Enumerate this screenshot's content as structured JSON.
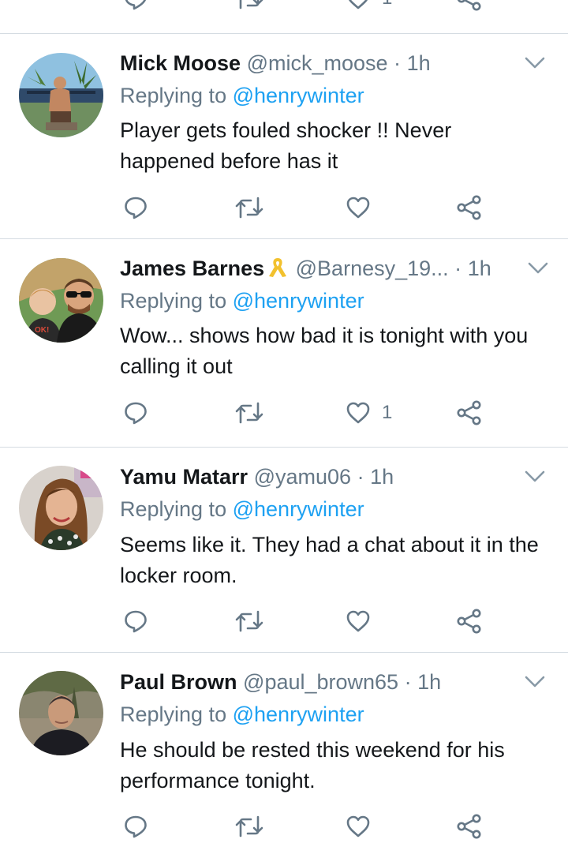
{
  "replying_label": "Replying to",
  "tweets": [
    {
      "name": "Mick Moose",
      "handle": "@mick_moose",
      "separator": "·",
      "time": "1h",
      "replying_to": "@henrywinter",
      "text": "Player gets fouled shocker !! Never happened before has it",
      "likes": ""
    },
    {
      "name": "James Barnes",
      "handle": "@Barnesy_19...",
      "separator": "·",
      "time": "1h",
      "replying_to": "@henrywinter",
      "text": "Wow... shows how bad it is tonight with you calling it out",
      "likes": "1"
    },
    {
      "name": "Yamu Matarr",
      "handle": "@yamu06",
      "separator": "·",
      "time": "1h",
      "replying_to": "@henrywinter",
      "text": "Seems like it. They had a chat about it in the locker room.",
      "likes": ""
    },
    {
      "name": "Paul Brown",
      "handle": "@paul_brown65",
      "separator": "·",
      "time": "1h",
      "replying_to": "@henrywinter",
      "text": "He should be rested this weekend for his performance tonight.",
      "likes": ""
    }
  ],
  "partial_tweet_above": {
    "likes": "1"
  },
  "colors": {
    "text": "#14171a",
    "secondary": "#657786",
    "link": "#1da1f2",
    "icon": "#657786",
    "divider": "#d5dce2",
    "ribbon": "#f2c12e"
  },
  "icons": [
    "reply-icon",
    "retweet-icon",
    "like-icon",
    "share-icon",
    "caret-down-icon",
    "yellow-ribbon-icon"
  ]
}
